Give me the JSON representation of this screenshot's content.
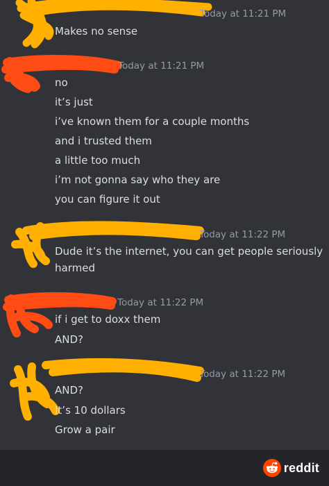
{
  "colors": {
    "background": "#313338",
    "text": "#dbdee1",
    "timestamp": "#949ba4",
    "scribble_orange": "#ffb000",
    "scribble_red": "#ff4b14",
    "footer": "#242529",
    "reddit_orange": "#ff4500"
  },
  "messages": [
    {
      "timestamp": "Today at 11:21 PM",
      "scribble_color": "orange",
      "lines": [
        "Makes no sense"
      ]
    },
    {
      "timestamp": "Today at 11:21 PM",
      "scribble_color": "red",
      "lines": [
        "no",
        "it’s just",
        "i’ve known them for a couple months",
        "and i trusted them",
        "a little too much",
        "i’m not gonna say who they are",
        "you can figure it out"
      ]
    },
    {
      "timestamp": "Today at 11:22 PM",
      "scribble_color": "orange",
      "lines": [
        "Dude it’s the internet, you can get people seriously",
        "harmed"
      ]
    },
    {
      "timestamp": "Today at 11:22 PM",
      "scribble_color": "red",
      "lines": [
        "if i get to doxx them",
        "AND?"
      ]
    },
    {
      "timestamp": "Today at 11:22 PM",
      "scribble_color": "orange",
      "lines": [
        "AND?",
        "It’s 10 dollars",
        "Grow a pair"
      ]
    }
  ],
  "footer": {
    "brand_icon": "reddit-snoo-icon",
    "brand": "reddit"
  }
}
